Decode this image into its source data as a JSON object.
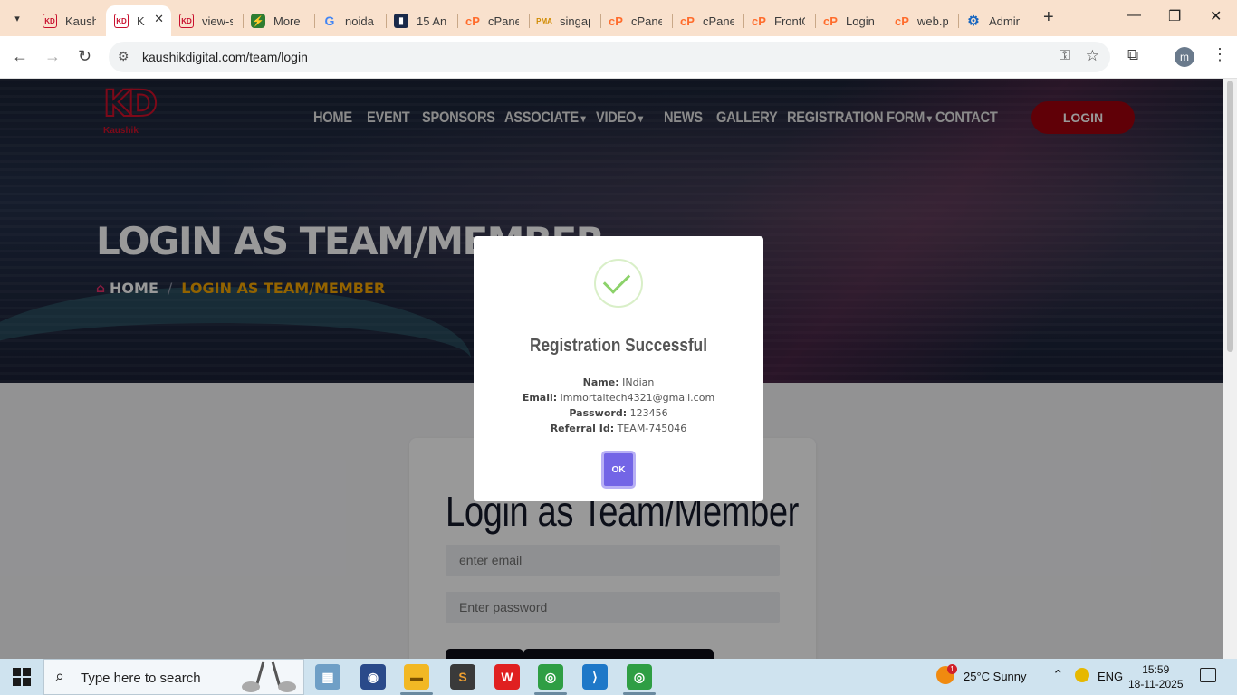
{
  "browser": {
    "tabs": [
      {
        "label": "Kaush",
        "favicon": "kd-icon",
        "active": false
      },
      {
        "label": "K",
        "favicon": "kd-icon",
        "active": true
      },
      {
        "label": "view-s",
        "favicon": "kd-icon",
        "active": false
      },
      {
        "label": "More",
        "favicon": "zap-icon",
        "active": false
      },
      {
        "label": "noida",
        "favicon": "google-icon",
        "active": false
      },
      {
        "label": "15 An",
        "favicon": "image-icon",
        "active": false
      },
      {
        "label": "cPane",
        "favicon": "cpanel-icon",
        "active": false
      },
      {
        "label": "singap",
        "favicon": "pma-icon",
        "active": false
      },
      {
        "label": "cPane",
        "favicon": "cpanel-icon",
        "active": false
      },
      {
        "label": "cPane",
        "favicon": "cpanel-icon",
        "active": false
      },
      {
        "label": "FrontO",
        "favicon": "cpanel-icon",
        "active": false
      },
      {
        "label": "Login",
        "favicon": "cpanel-icon",
        "active": false
      },
      {
        "label": "web.p",
        "favicon": "cpanel-icon",
        "active": false
      },
      {
        "label": "Admin",
        "favicon": "gear-icon",
        "active": false
      }
    ],
    "url": "kaushikdigital.com/team/login",
    "profile_initial": "m"
  },
  "site": {
    "logo_text": "KD",
    "logo_word": "Kaushik",
    "nav": [
      "HOME",
      "EVENT",
      "SPONSORS",
      "ASSOCIATE",
      "VIDEO",
      "NEWS",
      "GALLERY",
      "REGISTRATION FORM",
      "CONTACT"
    ],
    "nav_dropdowns": [
      "ASSOCIATE",
      "VIDEO",
      "REGISTRATION FORM"
    ],
    "login_label": "LOGIN",
    "hero_title": "LOGIN AS TEAM/MEMBER",
    "breadcrumb": {
      "home": "HOME",
      "separator": "/",
      "current": "LOGIN AS TEAM/MEMBER"
    }
  },
  "login_card": {
    "title": "Login as Team/Member",
    "email_placeholder": "enter email",
    "password_placeholder": "Enter password"
  },
  "modal": {
    "title": "Registration Successful",
    "fields": [
      {
        "key": "Name:",
        "value": "INdian"
      },
      {
        "key": "Email:",
        "value": "immortaltech4321@gmail.com"
      },
      {
        "key": "Password:",
        "value": "123456"
      },
      {
        "key": "Referral Id:",
        "value": "TEAM-745046"
      }
    ],
    "ok_label": "OK"
  },
  "taskbar": {
    "search_placeholder": "Type here to search",
    "weather": "25°C  Sunny",
    "weather_badge": "1",
    "language": "ENG",
    "time": "15:59",
    "date": "18-11-2025"
  },
  "colors": {
    "accent_red": "#a1000c",
    "breadcrumb_current": "#f5a500",
    "ok_button": "#7365e6",
    "success_check": "#8cd26a"
  }
}
